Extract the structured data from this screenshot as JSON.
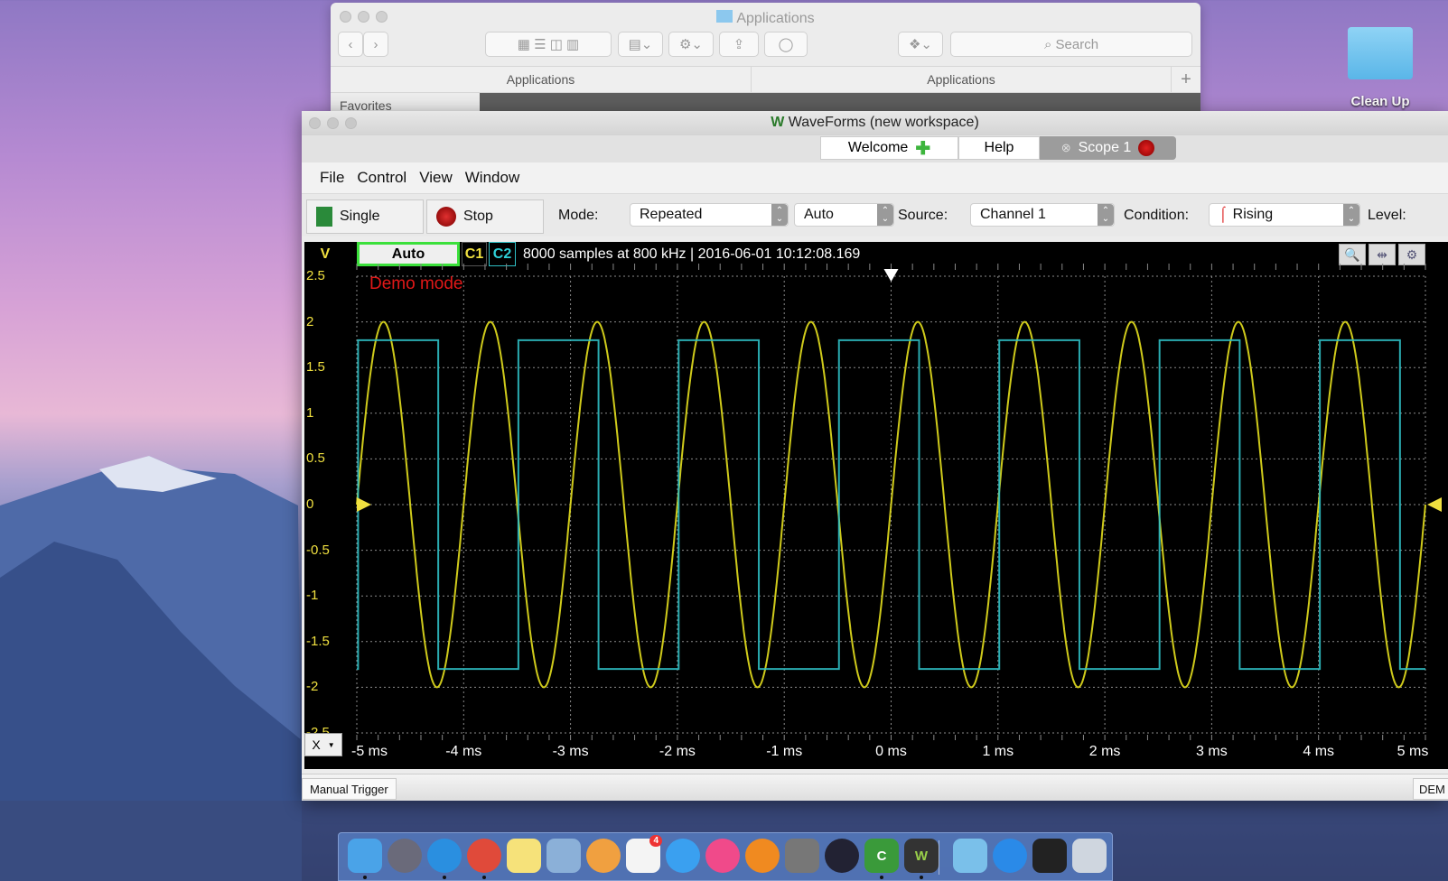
{
  "desktop": {
    "folder_label": "Clean Up"
  },
  "finder": {
    "title": "Applications",
    "search_placeholder": "Search",
    "path_tabs": [
      "Applications",
      "Applications"
    ],
    "sidebar_heading": "Favorites",
    "add_tab": "+"
  },
  "window": {
    "title": "WaveForms  (new workspace)",
    "tabs": [
      {
        "label": "Welcome"
      },
      {
        "label": "Help"
      },
      {
        "label": "Scope 1"
      }
    ],
    "menu": [
      "File",
      "Control",
      "View",
      "Window"
    ],
    "toolbar": {
      "single": "Single",
      "stop": "Stop",
      "mode_label": "Mode:",
      "mode_value": "Repeated",
      "auto_value": "Auto",
      "source_label": "Source:",
      "source_value": "Channel 1",
      "condition_label": "Condition:",
      "condition_value": "Rising",
      "level_label": "Level:"
    },
    "plot_header": {
      "unit": "V",
      "range_button": "Auto",
      "c1": "C1",
      "c2": "C2",
      "info": "8000 samples at 800 kHz | 2016-06-01 10:12:08.169"
    },
    "x_button": "X",
    "status": {
      "manual_trigger": "Manual Trigger",
      "right": "DEM"
    }
  },
  "chart_data": {
    "type": "line",
    "annotation": "Demo mode",
    "ylabel": "V",
    "ylim": [
      -2.5,
      2.5
    ],
    "xlim_ms": [
      -5,
      5
    ],
    "y_ticks": [
      "2.5",
      "2",
      "1.5",
      "1",
      "0.5",
      "0",
      "-0.5",
      "-1",
      "-1.5",
      "-2",
      "-2.5"
    ],
    "x_ticks": [
      "-5 ms",
      "-4 ms",
      "-3 ms",
      "-2 ms",
      "-1 ms",
      "0 ms",
      "1 ms",
      "2 ms",
      "3 ms",
      "4 ms",
      "5 ms"
    ],
    "grid": true,
    "trigger": {
      "time_ms": 0,
      "level_V": 0
    },
    "series": [
      {
        "name": "C1",
        "color": "#e6e01e",
        "waveform": "sine",
        "amplitude_V": 2,
        "period_ms": 1.0,
        "rising_zero_ms": 0
      },
      {
        "name": "C2",
        "color": "#2fbfc4",
        "waveform": "square",
        "amplitude_V": 1.8,
        "period_ms": 1.5,
        "rising_edge_ms": -0.49,
        "duty": 0.5
      }
    ]
  },
  "colors": {
    "plot_bg": "#000000",
    "c1": "#e6e01e",
    "c2": "#2fbfc4",
    "demo": "#e01818",
    "auto_border": "#3be03b"
  },
  "dock": {
    "items": [
      "finder",
      "launchpad",
      "safari",
      "chrome",
      "notes",
      "preview",
      "photos",
      "reminders",
      "messages",
      "itunes",
      "ibooks",
      "system-preferences",
      "quicktime",
      "camtasia",
      "waveforms",
      "downloads-folder",
      "app-store",
      "terminal",
      "trash"
    ],
    "reminders_badge": "4"
  }
}
